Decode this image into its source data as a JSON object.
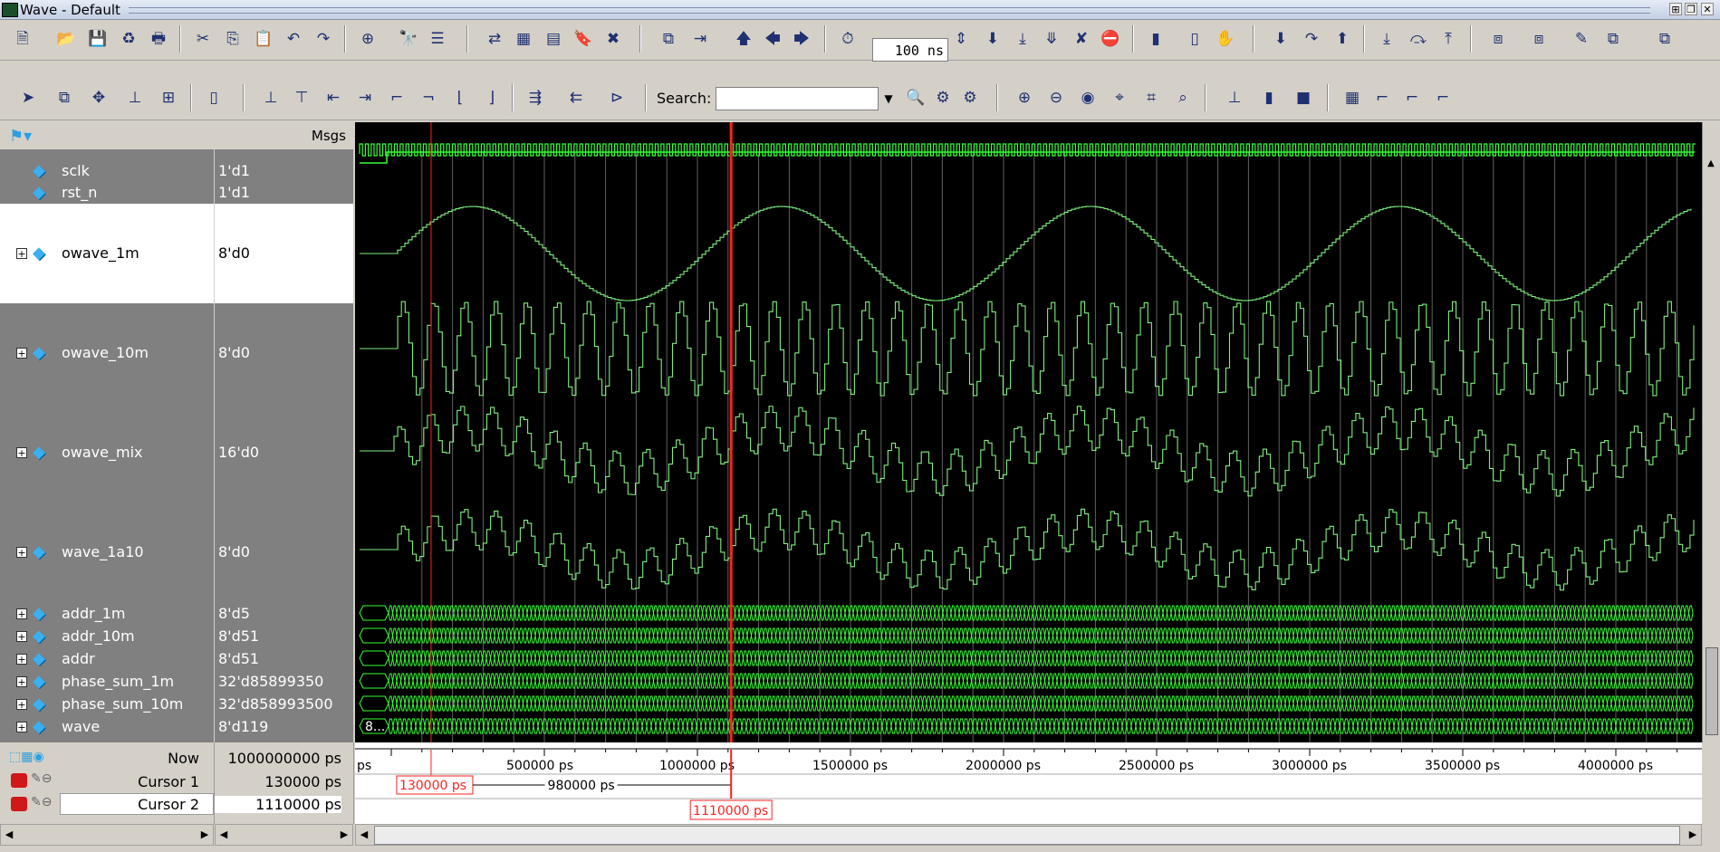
{
  "window": {
    "title": "Wave - Default"
  },
  "toolbar": {
    "zoom_value": "100 ns",
    "search_label": "Search:",
    "search_placeholder": ""
  },
  "pane_headers": {
    "messages": "Msgs"
  },
  "signals": [
    {
      "name": "sclk",
      "value": "1'd1",
      "expandable": false
    },
    {
      "name": "rst_n",
      "value": "1'd1",
      "expandable": false
    },
    {
      "name": "owave_1m",
      "value": "8'd0",
      "expandable": true
    },
    {
      "name": "owave_10m",
      "value": "8'd0",
      "expandable": true
    },
    {
      "name": "owave_mix",
      "value": "16'd0",
      "expandable": true
    },
    {
      "name": "wave_1a10",
      "value": "8'd0",
      "expandable": true
    },
    {
      "name": "addr_1m",
      "value": "8'd5",
      "expandable": true
    },
    {
      "name": "addr_10m",
      "value": "8'd51",
      "expandable": true
    },
    {
      "name": "addr",
      "value": "8'd51",
      "expandable": true
    },
    {
      "name": "phase_sum_1m",
      "value": "32'd85899350",
      "expandable": true
    },
    {
      "name": "phase_sum_10m",
      "value": "32'd858993500",
      "expandable": true
    },
    {
      "name": "wave",
      "value": "8'd119",
      "expandable": true
    }
  ],
  "wave_bus_start_label": "8...",
  "timeline": {
    "start_label": "ps",
    "ticks": [
      "500000 ps",
      "1000000 ps",
      "1500000 ps",
      "2000000 ps",
      "2500000 ps",
      "3000000 ps",
      "3500000 ps",
      "4000000 ps"
    ]
  },
  "cursors": {
    "now_label": "Now",
    "now_value": "1000000000 ps",
    "cursor1_label": "Cursor 1",
    "cursor1_value": "130000 ps",
    "cursor2_label": "Cursor 2",
    "cursor2_value": "1110000 ps",
    "cursor1_marker": "130000 ps",
    "cursor2_marker": "1110000 ps",
    "delta": "980000 ps"
  },
  "colors": {
    "wave_green": "#7ff07f",
    "bus_green": "#33ff33",
    "cursor_red": "#ff2020",
    "background": "#000000"
  }
}
